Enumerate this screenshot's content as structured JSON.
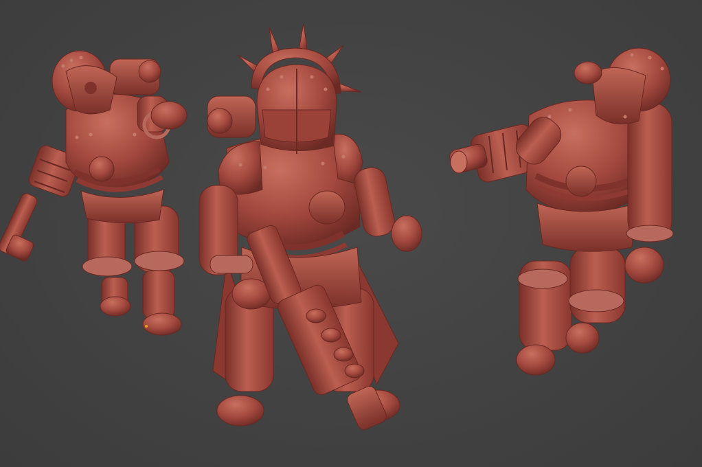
{
  "viewport": {
    "background_color": "#444444",
    "model_color": "#a4493f",
    "model_highlight": "#c4685b",
    "model_shadow": "#6e2a24",
    "origin_marker_color": "#e0a020"
  },
  "scene": {
    "objects": [
      {
        "name": "armored-soldier-left",
        "weapon": "cannon-gun"
      },
      {
        "name": "armored-soldier-center",
        "weapon": "long-rifle",
        "crown": "spiked-halo"
      },
      {
        "name": "armored-soldier-right",
        "weapon": "cannon-gun"
      }
    ],
    "origin_marker": "object-origin-dot"
  }
}
